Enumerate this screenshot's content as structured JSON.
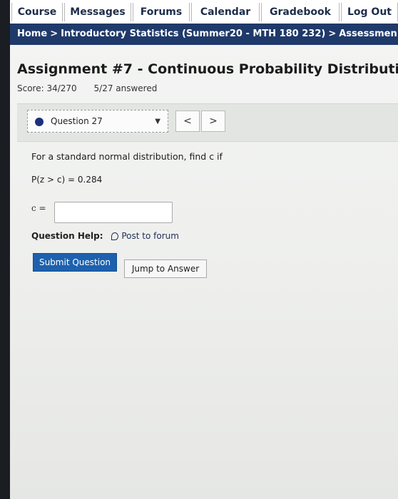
{
  "nav": {
    "tabs": [
      "Course",
      "Messages",
      "Forums",
      "Calendar",
      "Gradebook",
      "Log Out"
    ]
  },
  "breadcrumb": {
    "home": "Home",
    "course": "Introductory Statistics (Summer20 - MTH 180 232)",
    "section": "Assessmen"
  },
  "assignment": {
    "title": "Assignment #7 - Continuous Probability Distributi",
    "score": "Score: 34/270",
    "answered": "5/27 answered"
  },
  "question_nav": {
    "selected": "Question 27",
    "prev_glyph": "<",
    "next_glyph": ">"
  },
  "question": {
    "prompt": "For a standard normal distribution, find c if",
    "equation": "P(z > c) = 0.284",
    "answer_label": "c =",
    "answer_value": ""
  },
  "help": {
    "label": "Question Help:",
    "post_link": "Post to forum"
  },
  "buttons": {
    "submit": "Submit Question",
    "jump": "Jump to Answer"
  },
  "colors": {
    "breadcrumb_bg": "#1f3a6a",
    "submit_bg": "#1d61ae",
    "dot": "#1b2f7c"
  }
}
